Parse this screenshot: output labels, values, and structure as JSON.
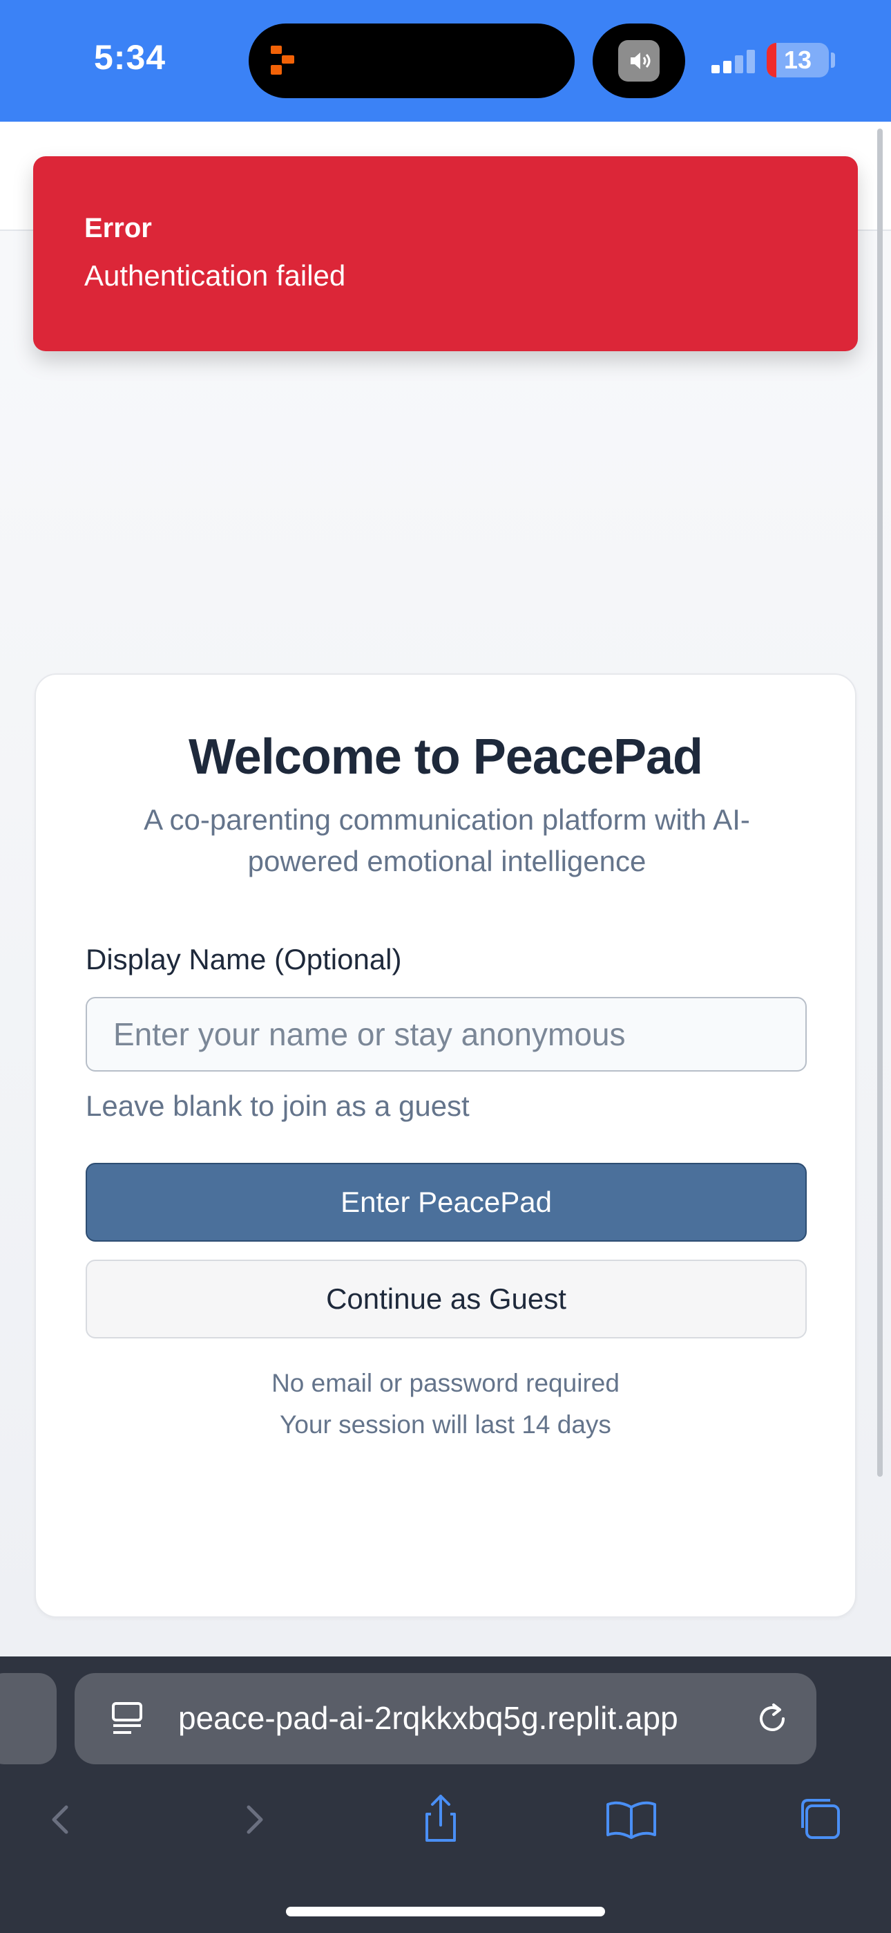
{
  "status_bar": {
    "time": "5:34",
    "battery": "13",
    "accent_color": "#3b82f6"
  },
  "error_toast": {
    "title": "Error",
    "message": "Authentication failed",
    "color": "#dc2638"
  },
  "login_card": {
    "title": "Welcome to PeacePad",
    "subtitle": "A co-parenting communication platform with AI-powered emotional intelligence",
    "display_name_label": "Display Name (Optional)",
    "display_name_placeholder": "Enter your name or stay anonymous",
    "display_name_value": "",
    "hint": "Leave blank to join as a guest",
    "primary_button": "Enter PeacePad",
    "secondary_button": "Continue as Guest",
    "footnote_1": "No email or password required",
    "footnote_2": "Your session will last 14 days"
  },
  "browser": {
    "url": "peace-pad-ai-2rqkkxbq5g.replit.app",
    "icons": [
      "page-menu-icon",
      "reload-icon",
      "back-icon",
      "forward-icon",
      "share-icon",
      "bookmarks-icon",
      "tabs-icon"
    ]
  }
}
